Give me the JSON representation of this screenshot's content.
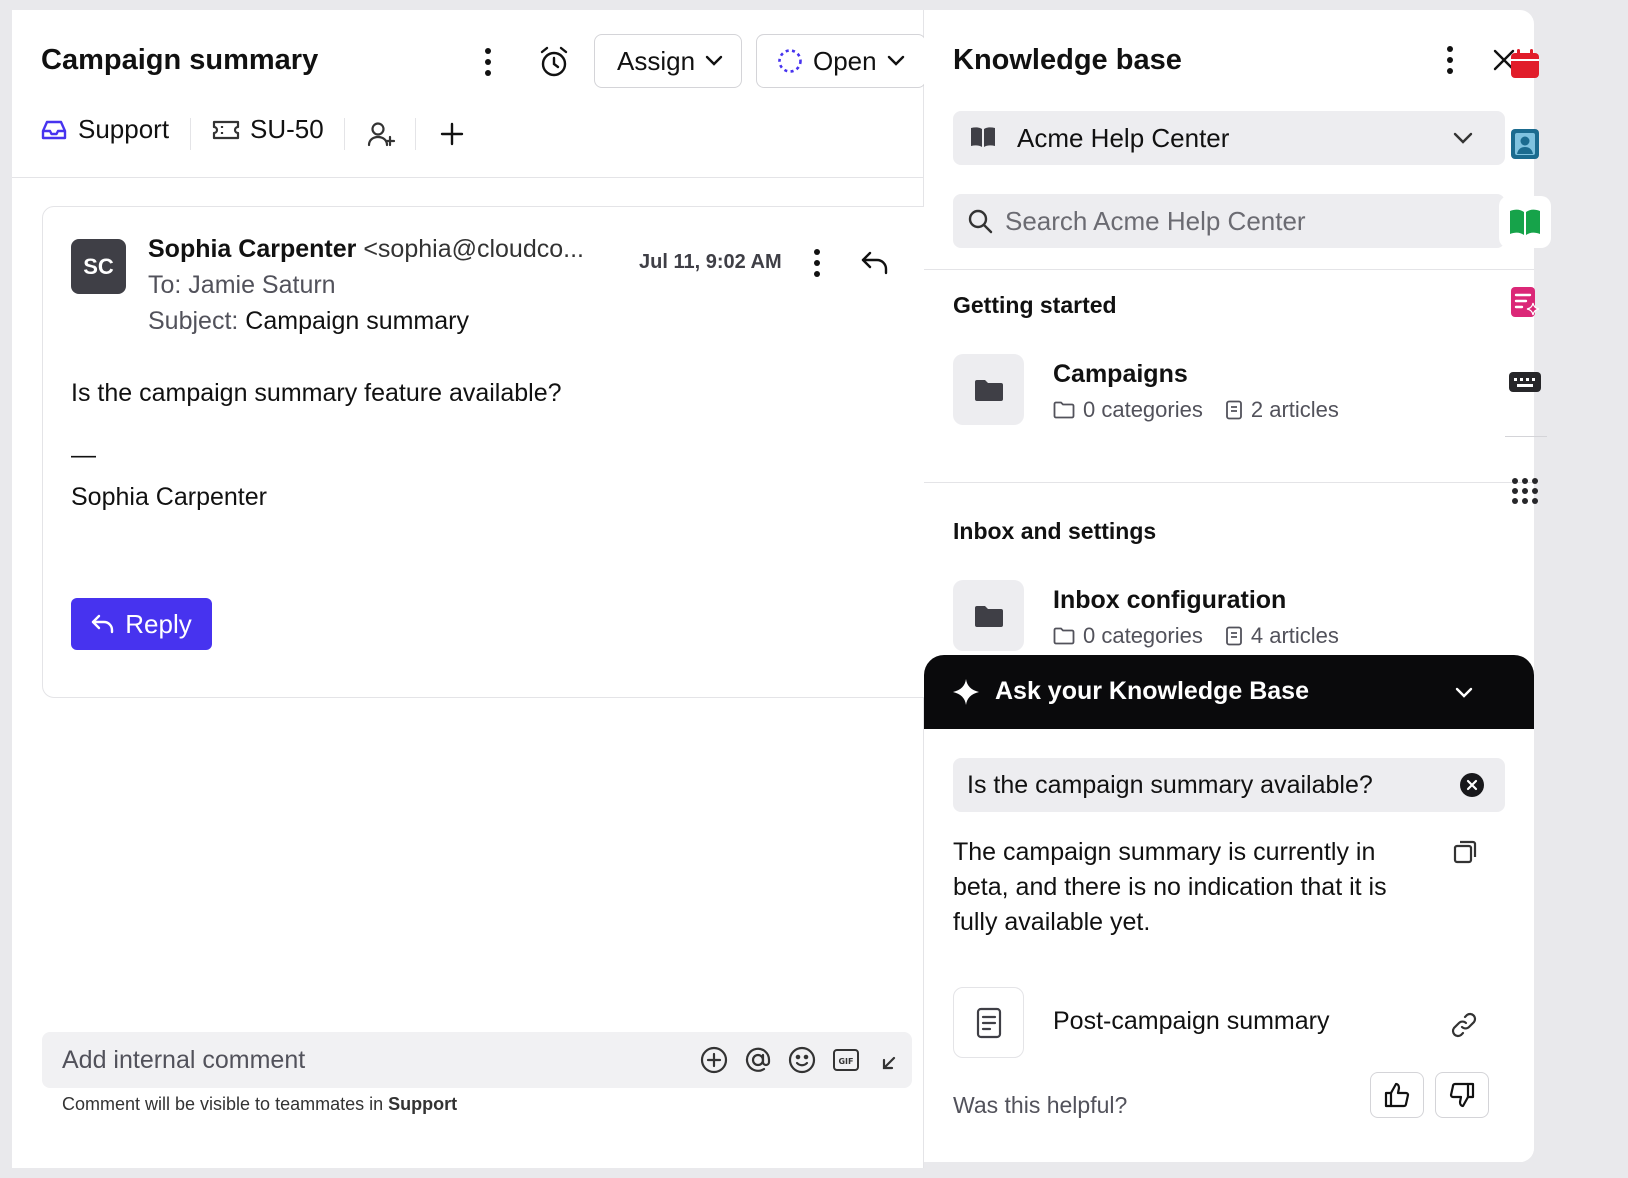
{
  "conversation": {
    "title": "Campaign summary",
    "assign_label": "Assign",
    "status_label": "Open",
    "tags": {
      "inbox": "Support",
      "ticket": "SU-50"
    },
    "email": {
      "avatar_initials": "SC",
      "sender_name": "Sophia Carpenter",
      "sender_email": "<sophia@cloudco...",
      "to_label": "To: Jamie Saturn",
      "subject_prefix": "Subject:",
      "subject": "Campaign summary",
      "date": "Jul 11, 9:02 AM",
      "body": "Is the campaign summary feature available?",
      "signature_dash": "—",
      "signature_name": "Sophia Carpenter",
      "reply_label": "Reply"
    },
    "comment": {
      "placeholder": "Add internal comment",
      "note_prefix": "Comment will be visible to teammates in",
      "note_inbox": "Support"
    }
  },
  "knowledge_base": {
    "title": "Knowledge base",
    "selected_center": "Acme Help Center",
    "search_placeholder": "Search Acme Help Center",
    "sections": [
      {
        "title": "Getting started",
        "collection": "Campaigns",
        "categories": "0 categories",
        "articles": "2 articles"
      },
      {
        "title": "Inbox and settings",
        "collection": "Inbox configuration",
        "categories": "0 categories",
        "articles": "4 articles"
      }
    ],
    "ask": {
      "title": "Ask your Knowledge Base",
      "question": "Is the campaign summary available?",
      "answer": "The campaign summary is currently in beta, and there is no indication that it is fully available yet.",
      "source": "Post-campaign summary",
      "helpful_label": "Was this helpful?"
    }
  },
  "colors": {
    "accent": "#4733ef",
    "calendar": "#e11d2a",
    "contacts": "#1b6b8f",
    "knowledge": "#16a34a",
    "notes": "#db2777"
  },
  "rail_icons": [
    "calendar-icon",
    "contact-card-icon",
    "knowledge-book-icon",
    "ai-notes-icon",
    "keyboard-icon",
    "apps-grid-icon"
  ]
}
